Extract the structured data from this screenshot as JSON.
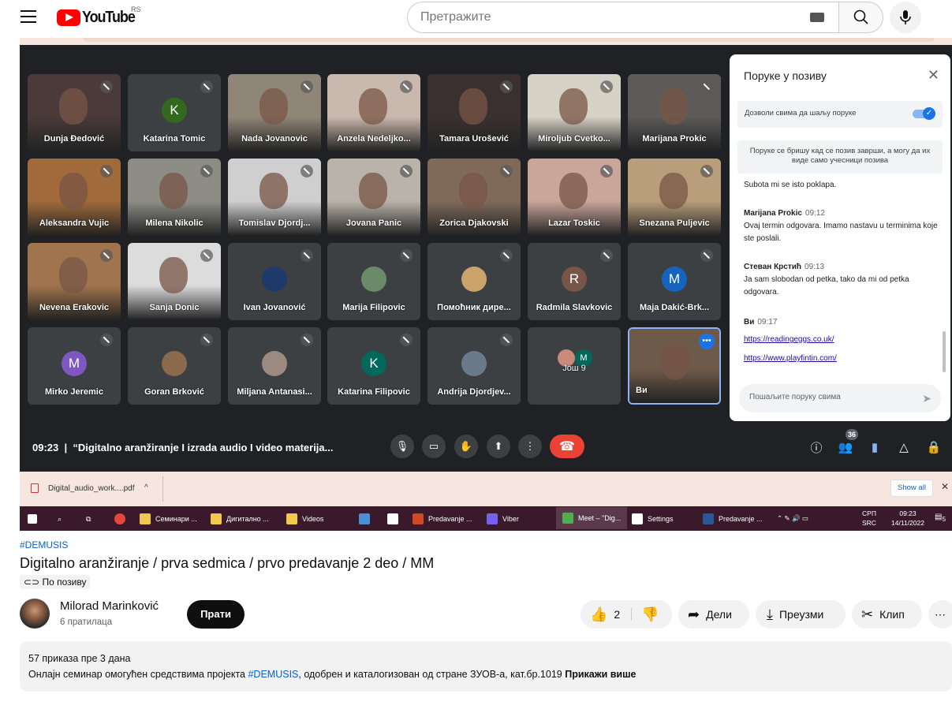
{
  "header": {
    "logo_text": "YouTube",
    "country": "RS",
    "search_placeholder": "Претражите"
  },
  "meet": {
    "participants": [
      {
        "name": "Dunja Đedović",
        "type": "cam",
        "bg": "#4a3a3a"
      },
      {
        "name": "Katarina Tomic",
        "type": "avatar",
        "initial": "K",
        "color": "#33691e"
      },
      {
        "name": "Nada Jovanovic",
        "type": "cam",
        "bg": "#8f8678"
      },
      {
        "name": "Anzela Nedeljko...",
        "type": "cam",
        "bg": "#c9b8ad"
      },
      {
        "name": "Tamara Urošević",
        "type": "cam",
        "bg": "#3a3030"
      },
      {
        "name": "Miroljub Cvetko...",
        "type": "cam",
        "bg": "#d7d2c6"
      },
      {
        "name": "Marijana Prokic",
        "type": "cam",
        "bg": "#5d5a5a"
      },
      {
        "name": "Aleksandra Vujic",
        "type": "cam",
        "bg": "#a06a3a"
      },
      {
        "name": "Milena Nikolic",
        "type": "cam",
        "bg": "#8d8d86"
      },
      {
        "name": "Tomislav Djordj...",
        "type": "cam",
        "bg": "#cfcfcf"
      },
      {
        "name": "Jovana Panic",
        "type": "cam",
        "bg": "#b9b3aa"
      },
      {
        "name": "Zorica Djakovski",
        "type": "cam",
        "bg": "#7f6a5a"
      },
      {
        "name": "Lazar Toskic",
        "type": "cam",
        "bg": "#c9a59a"
      },
      {
        "name": "Snezana Puljevic",
        "type": "cam",
        "bg": "#b89e7a"
      },
      {
        "name": "Nevena Erakovic",
        "type": "cam",
        "bg": "#a0744c"
      },
      {
        "name": "Sanja Donic",
        "type": "cam",
        "bg": "#dcdcdc"
      },
      {
        "name": "Ivan Jovanović",
        "type": "photo",
        "color": "#1e3a6b"
      },
      {
        "name": "Marija Filipovic",
        "type": "photo",
        "color": "#6b8a6a"
      },
      {
        "name": "Помоћник дире...",
        "type": "photo",
        "color": "#c9a36a"
      },
      {
        "name": "Radmila Slavkovic",
        "type": "avatar",
        "initial": "R",
        "color": "#795548"
      },
      {
        "name": "Maja Dakić-Brk...",
        "type": "avatar",
        "initial": "M",
        "color": "#1565c0"
      },
      {
        "name": "Mirko Jeremic",
        "type": "avatar",
        "initial": "M",
        "color": "#7e57c2"
      },
      {
        "name": "Goran Brković",
        "type": "photo",
        "color": "#8a6a4a"
      },
      {
        "name": "Miljana Antanasi...",
        "type": "photo",
        "color": "#9a8a80"
      },
      {
        "name": "Katarina Filipovic",
        "type": "avatar",
        "initial": "K",
        "color": "#00695c"
      },
      {
        "name": "Andrija Djordjev...",
        "type": "photo",
        "color": "#6a7a8a"
      },
      {
        "name": "Још 9",
        "type": "more"
      },
      {
        "name": "Ви",
        "type": "self",
        "bg": "#6d5a4a"
      }
    ],
    "more_initial": "M",
    "time": "09:23",
    "meeting_title": "“Digitalno aranžiranje I izrada audio I video materija...",
    "people_count": "36",
    "chat": {
      "title": "Поруке у позиву",
      "allow_label": "Дозволи свима да шаљу поруке",
      "notice": "Поруке се бришу кад се позив заврши, а могу да их виде само учесници позива",
      "prev_text": "Subota mi se isto poklapa.",
      "messages": [
        {
          "author": "Marijana Prokic",
          "time": "09:12",
          "text": "Ovaj termin odgovara. Imamo nastavu u terminima koje ste poslali."
        },
        {
          "author": "Стеван Крстић",
          "time": "09:13",
          "text": "Ja sam slobodan od petka, tako da mi od petka odgovara."
        },
        {
          "author": "Ви",
          "time": "09:17"
        }
      ],
      "link1": "https://readingeggs.co.uk/",
      "link2": "https://www.playfintin.com/",
      "input_placeholder": "Пошаљите поруку свима"
    }
  },
  "download": {
    "file": "Digital_audio_work....pdf",
    "show_all": "Show all"
  },
  "taskbar": {
    "items": [
      {
        "label": "Семинари ...",
        "color": "#f2c94c"
      },
      {
        "label": "Дигитално ...",
        "color": "#f2c94c"
      },
      {
        "label": "Videos",
        "color": "#f2c94c"
      },
      {
        "label": "",
        "color": "#4a90d9"
      },
      {
        "label": "",
        "color": "#ffffff"
      },
      {
        "label": "Predavanje ...",
        "color": "#d24726"
      },
      {
        "label": "Viber",
        "color": "#7360f2"
      },
      {
        "label": "Meet – \"Dig...",
        "color": "#4caf50"
      },
      {
        "label": "Settings",
        "color": "#ffffff"
      },
      {
        "label": "Predavanje ...",
        "color": "#2b579a"
      }
    ],
    "lang": "СРП",
    "lang2": "SRC",
    "time": "09:23",
    "date": "14/11/2022",
    "notif": "5"
  },
  "video_info": {
    "hashtag": "#DEMUSIS",
    "title": "Digitalno aranžiranje / prva sedmica / prvo predavanje 2 deo / MM",
    "visibility": "По позиву",
    "channel": "Milorad Marinković",
    "subscribers": "6 пратилаца",
    "subscribe": "Прати",
    "likes": "2",
    "share": "Дели",
    "download": "Преузми",
    "clip": "Клип",
    "views": "57 приказа  пре 3 дана",
    "desc_prefix": "Онлајн семинар омогућен средствима пројекта ",
    "desc_tag": "#DEMUSIS",
    "desc_suffix": ", одобрен и каталогизован од стране ЗУОВ-а, кат.бр.1019 ",
    "show_more": "Прикажи више"
  }
}
